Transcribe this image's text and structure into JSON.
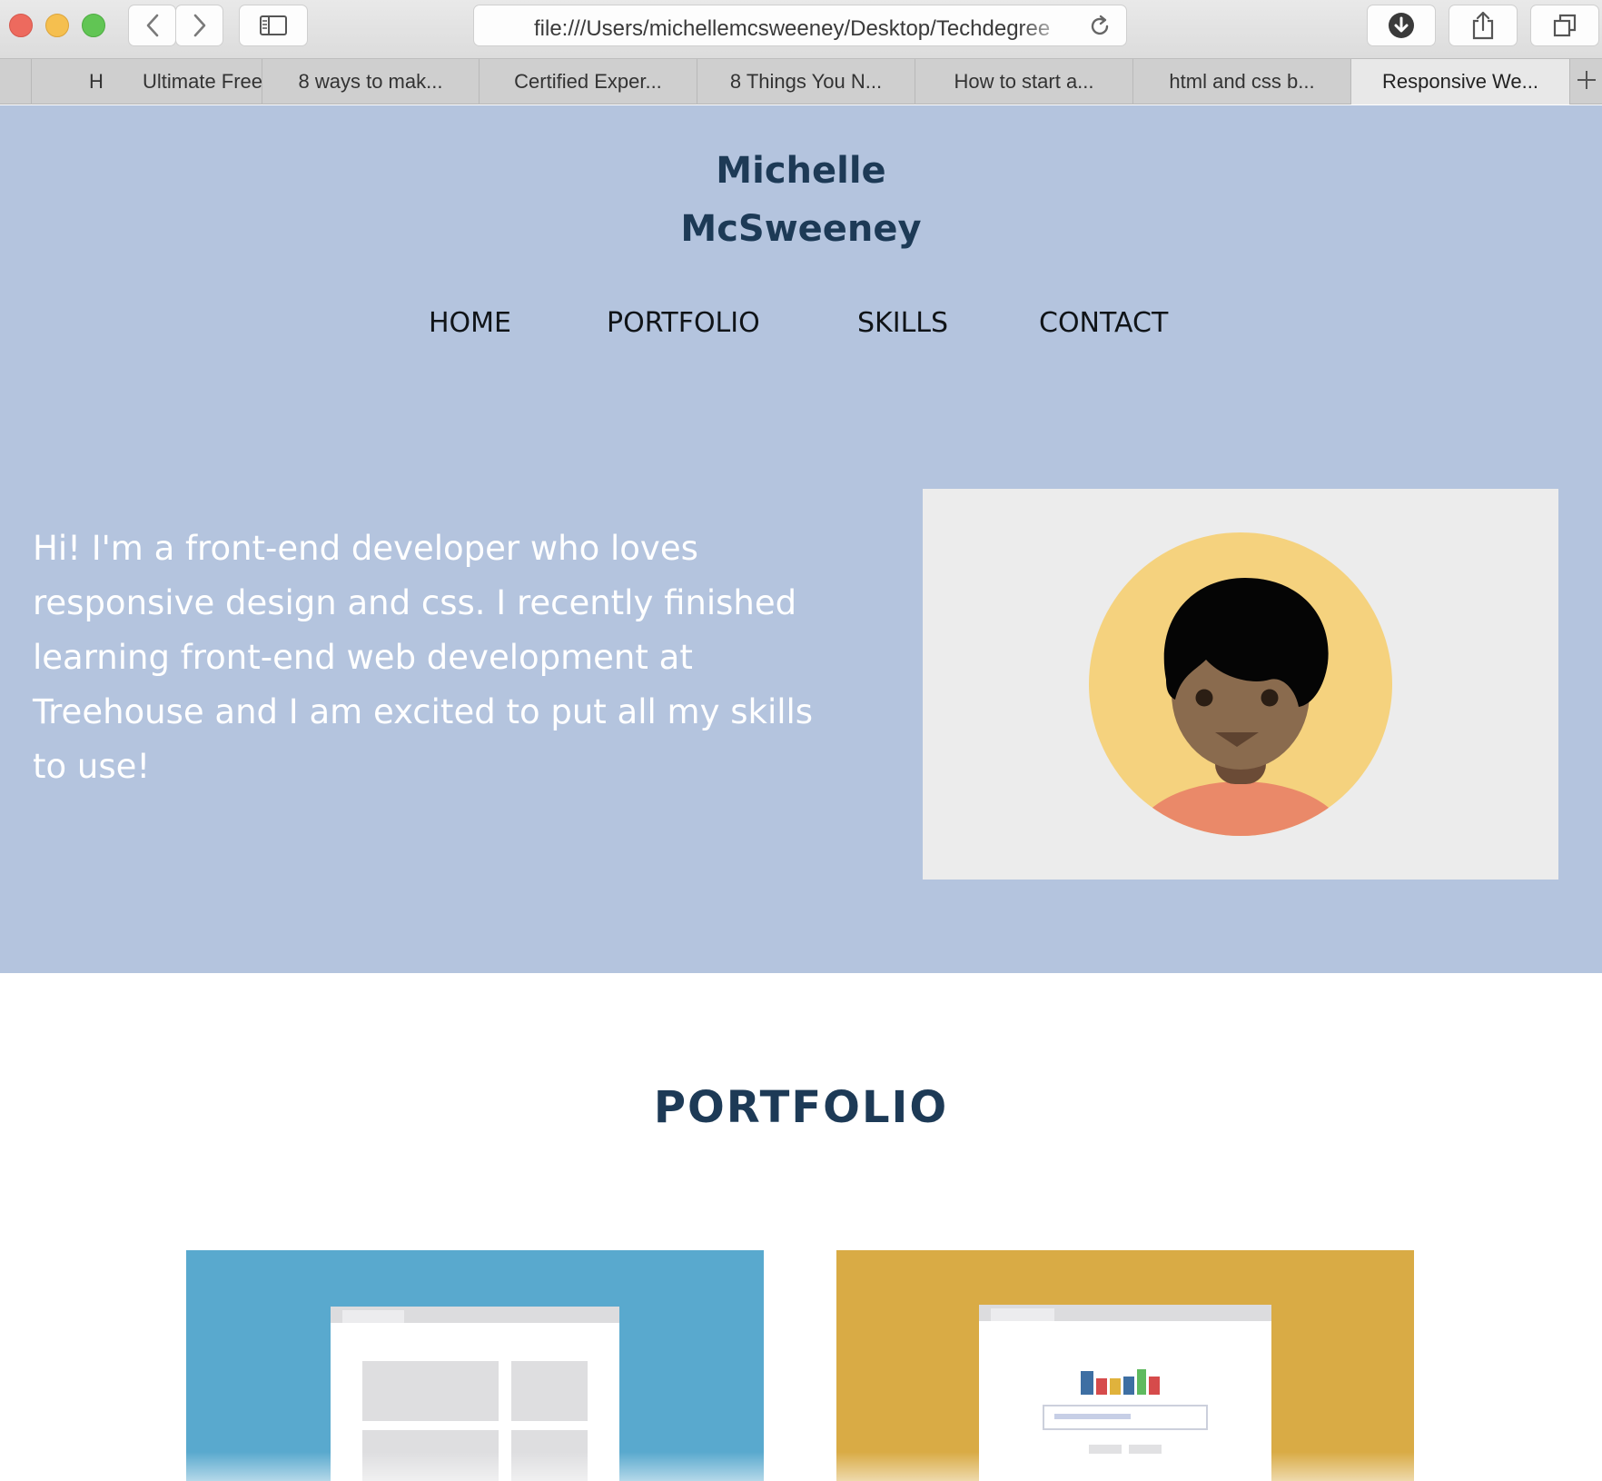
{
  "browser": {
    "url": "file:///Users/michellemcsweeney/Desktop/Techdegree",
    "tabs": [
      "H",
      "Ultimate Free",
      "8 ways to mak...",
      "Certified Exper...",
      "8 Things You N...",
      "How to start a...",
      "html and css b...",
      "Responsive We..."
    ],
    "active_tab_index": 7,
    "icons": {
      "back": "chevron-left-icon",
      "forward": "chevron-right-icon",
      "sidebar": "sidebar-icon",
      "reload": "reload-icon",
      "downloads": "download-icon",
      "share": "share-icon",
      "tabs": "tabs-overview-icon",
      "new_tab": "plus-icon"
    }
  },
  "header": {
    "name_line1": "Michelle",
    "name_line2": "McSweeney"
  },
  "nav": {
    "items": [
      "HOME",
      "PORTFOLIO",
      "SKILLS",
      "CONTACT"
    ]
  },
  "hero": {
    "intro": "Hi! I'm a front-end developer who loves responsive design and css. I recently finished learning front-end web development at Treehouse and I am excited to put all my skills to use!"
  },
  "portfolio": {
    "title": "PORTFOLIO"
  },
  "colors": {
    "hero_bg": "#b4c4de",
    "heading": "#1d3a56",
    "card_blue": "#59a9ce",
    "card_gold": "#d9ab45",
    "avatar_circle": "#f5d27e"
  }
}
